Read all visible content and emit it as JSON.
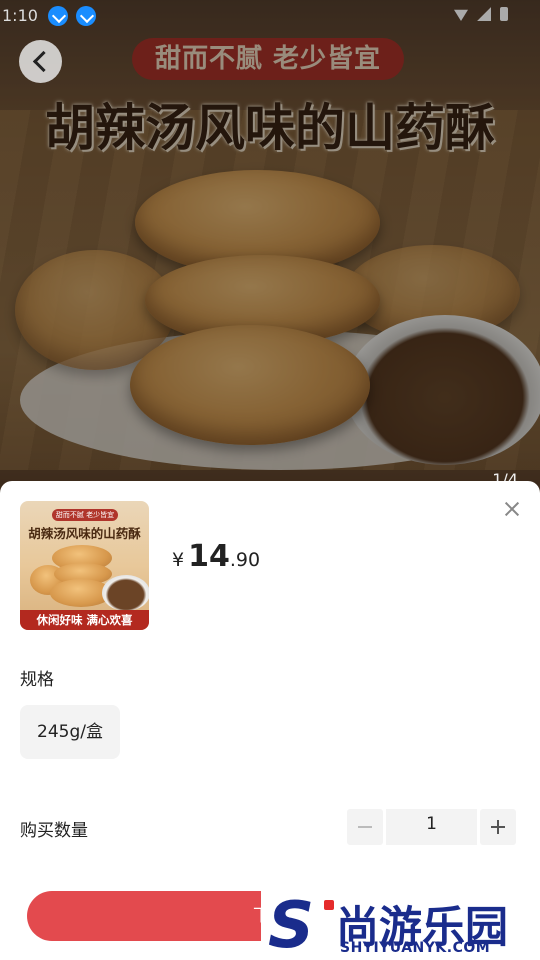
{
  "status_bar": {
    "time": "1:10"
  },
  "hero": {
    "subtitle": "甜而不腻 老少皆宜",
    "title": "胡辣汤风味的山药酥",
    "pager": "1/4"
  },
  "sheet": {
    "thumb": {
      "subtitle": "甜而不腻 老少皆宜",
      "title": "胡辣汤风味的山药酥",
      "banner": "休闲好味 满心欢喜"
    },
    "price": {
      "currency": "¥",
      "integer": "14",
      "decimal": ".90"
    },
    "spec": {
      "label": "规格",
      "option": "245g/盒"
    },
    "quantity": {
      "label": "购买数量",
      "value": "1"
    },
    "order_button": "下单"
  },
  "watermark": {
    "mark": "S",
    "name": "尚游乐园",
    "domain": "SHYIYUANYK.COM"
  }
}
